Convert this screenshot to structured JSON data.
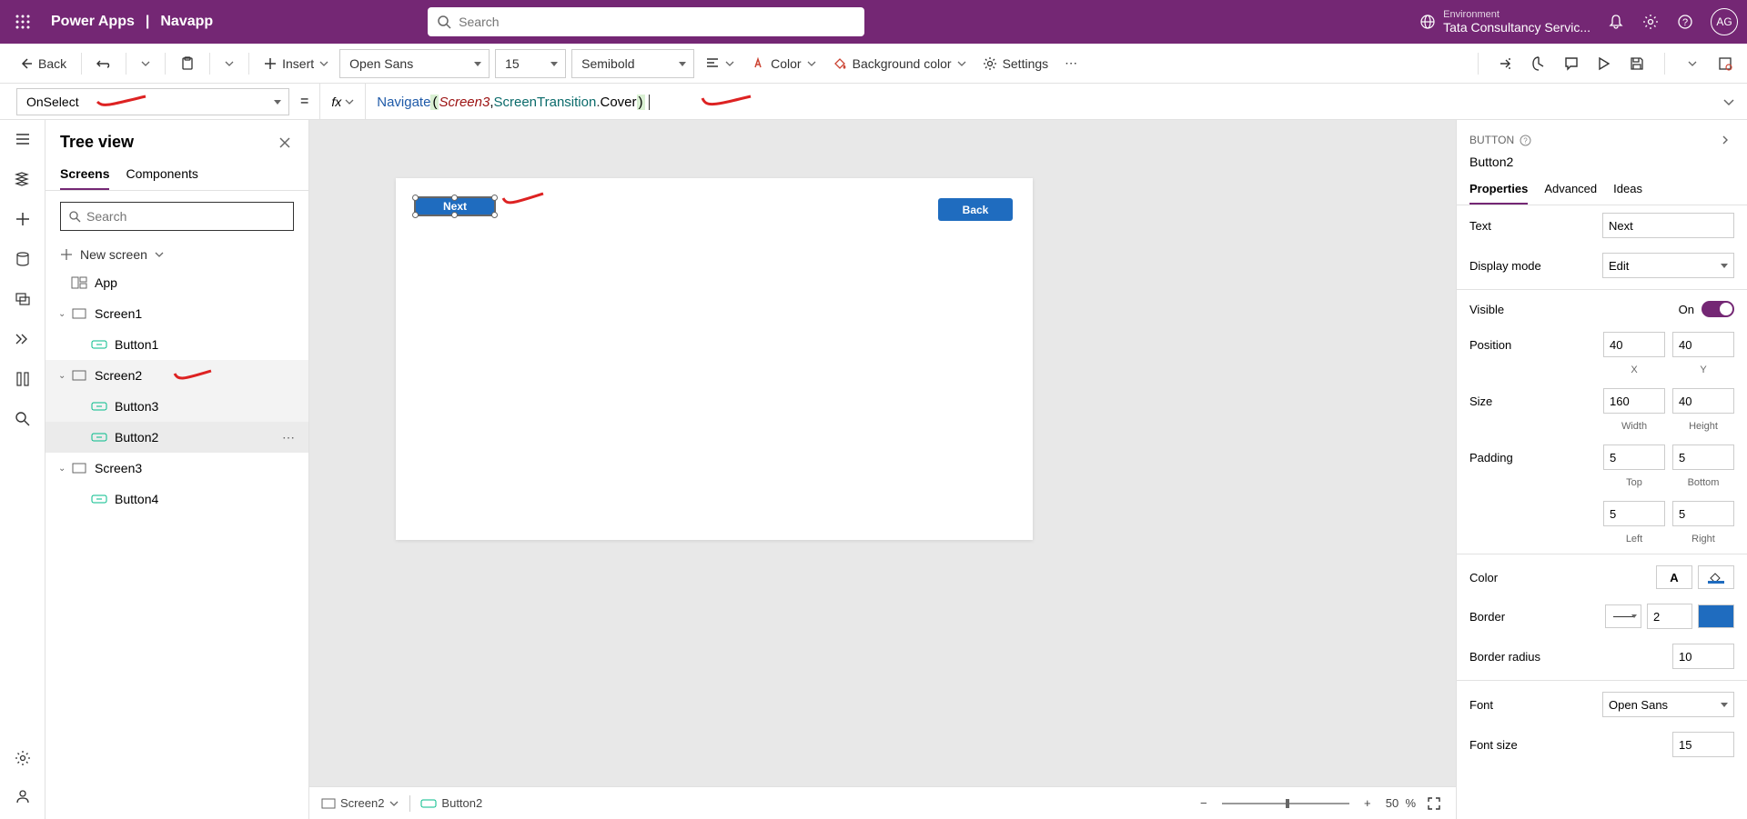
{
  "topbar": {
    "product": "Power Apps",
    "appName": "Navapp",
    "searchPlaceholder": "Search",
    "envLabel": "Environment",
    "envName": "Tata Consultancy Servic...",
    "avatar": "AG"
  },
  "toolbar": {
    "back": "Back",
    "insert": "Insert",
    "font": "Open Sans",
    "fontSize": "15",
    "weight": "Semibold",
    "color": "Color",
    "bgcolor": "Background color",
    "settings": "Settings"
  },
  "formula": {
    "property": "OnSelect",
    "fn": "Navigate",
    "arg1": "Screen3",
    "ns": "ScreenTransition",
    "method": "Cover"
  },
  "tree": {
    "title": "Tree view",
    "tab1": "Screens",
    "tab2": "Components",
    "searchPlaceholder": "Search",
    "newScreen": "New screen",
    "app": "App",
    "screen1": "Screen1",
    "button1": "Button1",
    "screen2": "Screen2",
    "button3": "Button3",
    "button2": "Button2",
    "screen3": "Screen3",
    "button4": "Button4"
  },
  "canvas": {
    "nextBtn": "Next",
    "backBtn": "Back"
  },
  "statusbar": {
    "screen": "Screen2",
    "control": "Button2",
    "zoom": "50",
    "pct": "%"
  },
  "props": {
    "type": "BUTTON",
    "name": "Button2",
    "tab1": "Properties",
    "tab2": "Advanced",
    "tab3": "Ideas",
    "text_label": "Text",
    "text_value": "Next",
    "displaymode_label": "Display mode",
    "displaymode_value": "Edit",
    "visible_label": "Visible",
    "visible_on": "On",
    "position_label": "Position",
    "pos_x": "40",
    "pos_y": "40",
    "x_label": "X",
    "y_label": "Y",
    "size_label": "Size",
    "size_w": "160",
    "size_h": "40",
    "w_label": "Width",
    "h_label": "Height",
    "padding_label": "Padding",
    "pad_t": "5",
    "pad_b": "5",
    "pad_l": "5",
    "pad_r": "5",
    "top_label": "Top",
    "bottom_label": "Bottom",
    "left_label": "Left",
    "right_label": "Right",
    "color_label": "Color",
    "border_label": "Border",
    "border_w": "2",
    "borderradius_label": "Border radius",
    "borderradius_v": "10",
    "font_label": "Font",
    "font_v": "Open Sans",
    "fontsize_label": "Font size",
    "fontsize_v": "15"
  }
}
